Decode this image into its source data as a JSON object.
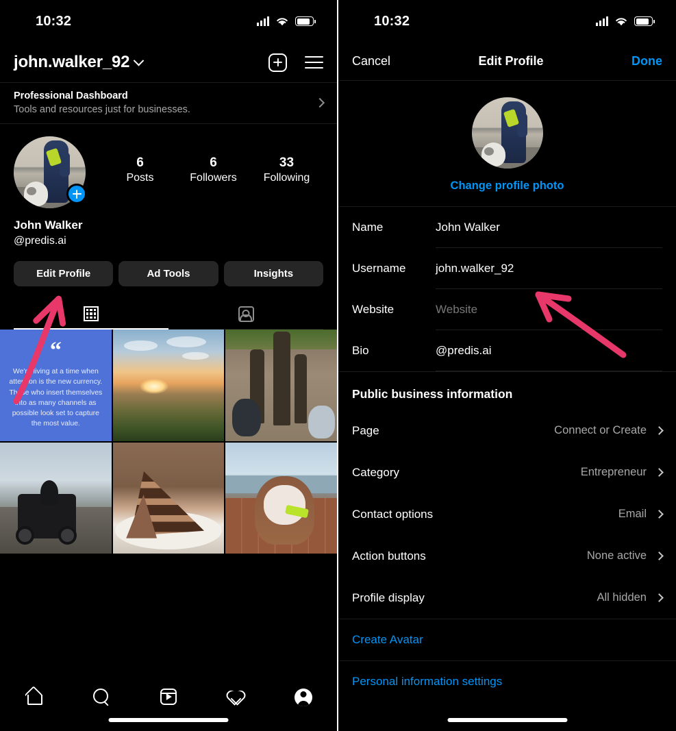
{
  "status_bar": {
    "time": "10:32",
    "signal_icon": "cellular-signal-icon",
    "wifi_icon": "wifi-icon",
    "battery_icon": "battery-icon"
  },
  "accent_colors": {
    "link_blue": "#0095f6",
    "annotation_pink": "#e8386a",
    "quote_card_blue": "#4f72d9",
    "button_gray": "#262626",
    "background": "#000000",
    "secondary_text": "#a8a8a8"
  },
  "left_screen": {
    "header": {
      "username": "john.walker_92",
      "chevron_icon": "chevron-down-icon",
      "add_icon": "plus-square-icon",
      "menu_icon": "hamburger-menu-icon"
    },
    "professional_dashboard": {
      "title": "Professional Dashboard",
      "subtitle": "Tools and resources just for businesses.",
      "chevron_icon": "chevron-right-icon"
    },
    "profile": {
      "avatar_alt": "person-walking-dog-avatar",
      "add_story_icon": "plus-circle-icon",
      "display_name": "John Walker",
      "bio": "@predis.ai",
      "stats": [
        {
          "number": "6",
          "label": "Posts"
        },
        {
          "number": "6",
          "label": "Followers"
        },
        {
          "number": "33",
          "label": "Following"
        }
      ],
      "buttons": [
        {
          "label": "Edit Profile"
        },
        {
          "label": "Ad Tools"
        },
        {
          "label": "Insights"
        }
      ]
    },
    "tabs": [
      {
        "icon": "grid-icon",
        "active": true
      },
      {
        "icon": "tagged-person-icon",
        "active": false
      }
    ],
    "posts": [
      {
        "type": "quote-card",
        "quote_mark": "“",
        "text": "We're living at a time when attention is the new currency. Those who insert themselves into as many channels as possible look set to capture the most value."
      },
      {
        "type": "photo",
        "alt": "sunset-coastline-photo"
      },
      {
        "type": "photo",
        "alt": "shadows-of-people-and-dogs-photo"
      },
      {
        "type": "photo",
        "alt": "motorcycle-on-mountain-road-photo"
      },
      {
        "type": "photo",
        "alt": "chocolate-layer-cake-slice-photo"
      },
      {
        "type": "photo",
        "alt": "bulldog-on-deck-photo"
      }
    ],
    "tabbar": [
      {
        "icon": "home-icon"
      },
      {
        "icon": "search-icon"
      },
      {
        "icon": "reels-icon"
      },
      {
        "icon": "heart-icon"
      },
      {
        "icon": "profile-avatar-icon"
      }
    ]
  },
  "right_screen": {
    "nav": {
      "cancel": "Cancel",
      "title": "Edit Profile",
      "done": "Done"
    },
    "photo": {
      "avatar_alt": "person-walking-dog-avatar",
      "change_label": "Change profile photo"
    },
    "fields": [
      {
        "label": "Name",
        "value": "John Walker",
        "placeholder": "Name",
        "is_placeholder": false
      },
      {
        "label": "Username",
        "value": "john.walker_92",
        "placeholder": "Username",
        "is_placeholder": false
      },
      {
        "label": "Website",
        "value": "Website",
        "placeholder": "Website",
        "is_placeholder": true
      },
      {
        "label": "Bio",
        "value": "@predis.ai",
        "placeholder": "Bio",
        "is_placeholder": false
      }
    ],
    "business_section": {
      "heading": "Public business information",
      "rows": [
        {
          "label": "Page",
          "value": "Connect or Create",
          "chevron": "chevron-right-icon"
        },
        {
          "label": "Category",
          "value": "Entrepreneur",
          "chevron": "chevron-right-icon"
        },
        {
          "label": "Contact options",
          "value": "Email",
          "chevron": "chevron-right-icon"
        },
        {
          "label": "Action buttons",
          "value": "None active",
          "chevron": "chevron-right-icon"
        },
        {
          "label": "Profile display",
          "value": "All hidden",
          "chevron": "chevron-right-icon"
        }
      ]
    },
    "links": [
      {
        "label": "Create Avatar"
      },
      {
        "label": "Personal information settings"
      }
    ]
  }
}
